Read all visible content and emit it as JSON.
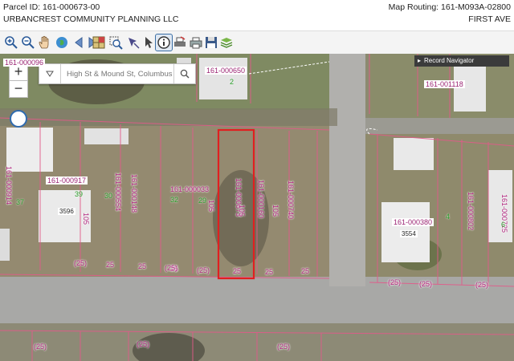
{
  "header": {
    "parcel_id": "Parcel ID: 161-000673-00",
    "map_routing": "Map Routing: 161-M093A-02800",
    "owner": "URBANCREST COMMUNITY PLANNING LLC",
    "address": "FIRST AVE"
  },
  "toolbar": {
    "tools": [
      "zoom-in-icon",
      "zoom-out-icon",
      "pan-hand-icon",
      "globe-icon",
      "back-arrow-icon",
      "forward-arrow-icon",
      "map-grid-icon",
      "zoom-box-icon",
      "select-arrow-icon",
      "select-cursor-icon",
      "info-icon",
      "print-icon",
      "printer-alt-icon",
      "save-disk-icon",
      "layers-icon"
    ],
    "active_tool": "info-icon"
  },
  "map": {
    "search": {
      "placeholder": "High St & Mound St, Columbus"
    },
    "zoom_in": "+",
    "zoom_out": "−",
    "record_navigator": "Record Navigator",
    "parcel_labels": {
      "p_000650": "161-000650",
      "p_001118": "161-001118",
      "p_000917": "161-000917",
      "p_000033": "161-000033",
      "p_000380": "161-000380",
      "p_000096": "161-000096",
      "p_000914": "161-000914",
      "p_000554": "161-000554",
      "p_000148": "161-000148",
      "p_000673": "161-000673",
      "p_000160": "161-000160",
      "p_000740": "161-000740",
      "p_000802": "161-000802",
      "p_000725": "161-000725"
    },
    "house_numbers": {
      "h_3596": "3596",
      "h_3554": "3554"
    },
    "green_numbers": [
      "2",
      "30",
      "32",
      "29",
      "39",
      "37",
      "4",
      "6"
    ],
    "dimensions": [
      "25",
      "25",
      "25",
      "25",
      "25",
      "25",
      "(25)",
      "(25)",
      "(25)",
      "(25)",
      "(25)",
      "(25)",
      "105",
      "105",
      "105",
      "105",
      "(25)",
      "(25)",
      "(25)"
    ]
  },
  "colors": {
    "selected_parcel": "#e02020",
    "parcel_line": "#e25a8a",
    "label": "#b0277e"
  }
}
